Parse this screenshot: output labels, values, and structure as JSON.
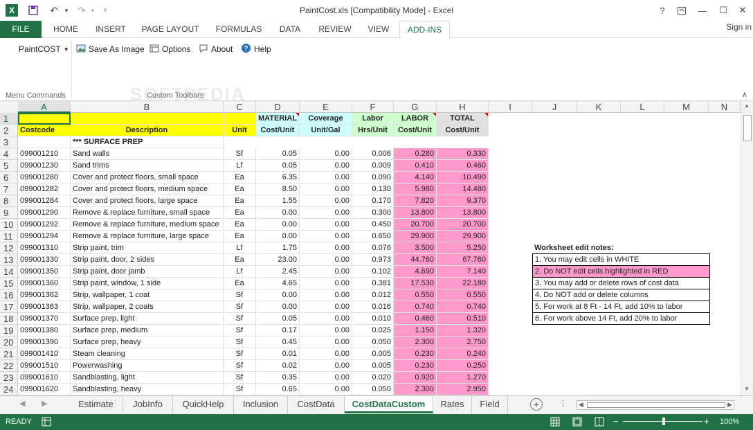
{
  "window": {
    "title": "PaintCost.xls  [Compatibility Mode] - Excel",
    "app_icon": "X"
  },
  "quick_access": {
    "save_icon": "save-icon",
    "undo_icon": "undo-icon",
    "redo_icon": "redo-icon",
    "customize_icon": "customize-icon"
  },
  "tabs": [
    "FILE",
    "HOME",
    "INSERT",
    "PAGE LAYOUT",
    "FORMULAS",
    "DATA",
    "REVIEW",
    "VIEW",
    "ADD-INS"
  ],
  "signin": "Sign in",
  "ribbon": {
    "paintcost": "PaintCOST",
    "save_as_image": "Save As Image",
    "options": "Options",
    "about": "About",
    "help": "Help",
    "group_menu": "Menu Commands",
    "group_toolbars": "Custom Toolbars",
    "watermark": "SOFTPEDIA"
  },
  "columns": [
    "A",
    "B",
    "C",
    "D",
    "E",
    "F",
    "G",
    "H",
    "I",
    "J",
    "K",
    "L",
    "M",
    "N"
  ],
  "header_row1": {
    "D": "MATERIAL",
    "E": "Coverage",
    "F": "Labor",
    "G": "LABOR",
    "H": "TOTAL"
  },
  "header_row2": {
    "A": "Costcode",
    "B": "Description",
    "C": "Unit",
    "D": "Cost/Unit",
    "E": "Unit/Gal",
    "F": "Hrs/Unit",
    "G": "Cost/Unit",
    "H": "Cost/Unit"
  },
  "row3_label": "*** SURFACE PREP",
  "rows": [
    [
      "099001210",
      "Sand walls",
      "Sf",
      "0.05",
      "0.00",
      "0.006",
      "0.280",
      "0.330"
    ],
    [
      "099001230",
      "Sand trims",
      "Lf",
      "0.05",
      "0.00",
      "0.009",
      "0.410",
      "0.460"
    ],
    [
      "099001280",
      "Cover and protect floors, small space",
      "Ea",
      "6.35",
      "0.00",
      "0.090",
      "4.140",
      "10.490"
    ],
    [
      "099001282",
      "Cover and protect floors, medium space",
      "Ea",
      "8.50",
      "0.00",
      "0.130",
      "5.980",
      "14.480"
    ],
    [
      "099001284",
      "Cover and protect floors, large space",
      "Ea",
      "1.55",
      "0.00",
      "0.170",
      "7.820",
      "9.370"
    ],
    [
      "099001290",
      "Remove & replace furniture, small space",
      "Ea",
      "0.00",
      "0.00",
      "0.300",
      "13.800",
      "13.800"
    ],
    [
      "099001292",
      "Remove & replace furniture, medium space",
      "Ea",
      "0.00",
      "0.00",
      "0.450",
      "20.700",
      "20.700"
    ],
    [
      "099001294",
      "Remove & replace furniture, large space",
      "Ea",
      "0.00",
      "0.00",
      "0.650",
      "29.900",
      "29.900"
    ],
    [
      "099001310",
      "Strip paint, trim",
      "Lf",
      "1.75",
      "0.00",
      "0.076",
      "3.500",
      "5.250"
    ],
    [
      "099001330",
      "Strip paint, door, 2 sides",
      "Ea",
      "23.00",
      "0.00",
      "0.973",
      "44.760",
      "67.760"
    ],
    [
      "099001350",
      "Strip paint, door jamb",
      "Lf",
      "2.45",
      "0.00",
      "0.102",
      "4.690",
      "7.140"
    ],
    [
      "099001360",
      "Strip paint, window, 1 side",
      "Ea",
      "4.65",
      "0.00",
      "0.381",
      "17.530",
      "22.180"
    ],
    [
      "099001362",
      "Strip, wallpaper, 1 coat",
      "Sf",
      "0.00",
      "0.00",
      "0.012",
      "0.550",
      "0.550"
    ],
    [
      "099001363",
      "Strip, wallpaper, 2 coats",
      "Sf",
      "0.00",
      "0.00",
      "0.016",
      "0.740",
      "0.740"
    ],
    [
      "099001370",
      "Surface prep, light",
      "Sf",
      "0.05",
      "0.00",
      "0.010",
      "0.460",
      "0.510"
    ],
    [
      "099001380",
      "Surface prep, medium",
      "Sf",
      "0.17",
      "0.00",
      "0.025",
      "1.150",
      "1.320"
    ],
    [
      "099001390",
      "Surface prep, heavy",
      "Sf",
      "0.45",
      "0.00",
      "0.050",
      "2.300",
      "2.750"
    ],
    [
      "099001410",
      "Steam cleaning",
      "Sf",
      "0.01",
      "0.00",
      "0.005",
      "0.230",
      "0.240"
    ],
    [
      "099001510",
      "Powerwashing",
      "Sf",
      "0.02",
      "0.00",
      "0.005",
      "0.230",
      "0.250"
    ],
    [
      "099001610",
      "Sandblasting, light",
      "Sf",
      "0.35",
      "0.00",
      "0.020",
      "0.920",
      "1.270"
    ],
    [
      "099001620",
      "Sandblasting, heavy",
      "Sf",
      "0.65",
      "0.00",
      "0.050",
      "2.300",
      "2.950"
    ]
  ],
  "notes": {
    "title": "Worksheet edit notes:",
    "items": [
      "1. You may edit cells in WHITE",
      "2. Do NOT edit cells highlighted in RED",
      "3. You may add or delete rows of cost data",
      "4. Do NOT add or delete columns",
      "5. For work at 8 Ft - 14 Ft, add 10% to labor",
      "6. For work above 14 Ft, add 20% to labor"
    ]
  },
  "sheets": [
    "Estimate",
    "JobInfo",
    "QuickHelp",
    "Inclusion",
    "CostData",
    "CostDataCustom",
    "Rates",
    "Field"
  ],
  "active_sheet": "CostDataCustom",
  "status": {
    "ready": "READY",
    "zoom": "100%"
  },
  "colors": {
    "accent": "#217346",
    "yellow": "#ffff00",
    "pink": "#ff99cc",
    "cyan": "#ccffff",
    "green": "#ccffcc"
  }
}
